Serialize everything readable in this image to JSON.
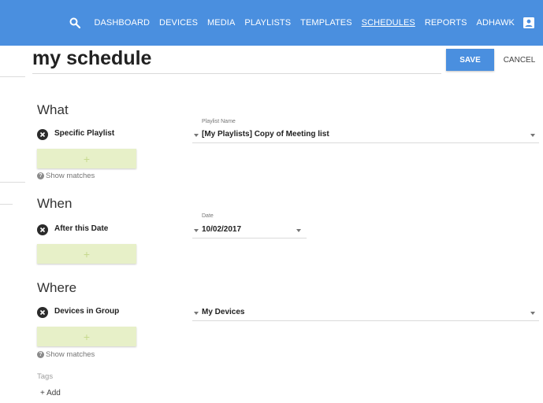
{
  "nav": {
    "items": [
      "DASHBOARD",
      "DEVICES",
      "MEDIA",
      "PLAYLISTS",
      "TEMPLATES",
      "SCHEDULES",
      "REPORTS",
      "ADHAWK"
    ],
    "active": "SCHEDULES",
    "search_icon": "search-icon",
    "account_icon": "account-box-icon"
  },
  "header": {
    "title": "my schedule",
    "save_label": "SAVE",
    "cancel_label": "CANCEL"
  },
  "what": {
    "heading": "What",
    "criteria": "Specific Playlist",
    "field_label": "Playlist Name",
    "field_value": "[My Playlists] Copy of Meeting list",
    "add_label": "+",
    "show_matches": "Show matches"
  },
  "when": {
    "heading": "When",
    "criteria": "After this Date",
    "field_label": "Date",
    "field_value": "10/02/2017",
    "add_label": "+"
  },
  "where": {
    "heading": "Where",
    "criteria": "Devices in Group",
    "field_value": "My Devices",
    "add_label": "+",
    "show_matches": "Show matches"
  },
  "tags": {
    "label": "Tags",
    "add_label": "+ Add"
  },
  "colors": {
    "primary": "#4a8fdf",
    "add_button": "#e7f0c8"
  }
}
